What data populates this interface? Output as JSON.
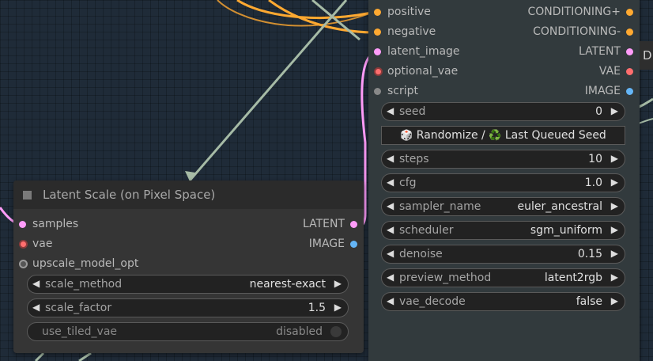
{
  "colors": {
    "canvas_bg": "#1f2b38",
    "node_bg": "#353535",
    "conditioning": "#ffa931",
    "latent": "#ff9cf9",
    "vae": "#ff6e6e",
    "image": "#64b5f6",
    "script": "#888888",
    "wire_image": "#a6bba6"
  },
  "ksampler": {
    "inputs": [
      {
        "label": "positive",
        "color": "#ffa931"
      },
      {
        "label": "negative",
        "color": "#ffa931"
      },
      {
        "label": "latent_image",
        "color": "#ff9cf9"
      },
      {
        "label": "optional_vae",
        "color": "#ff6e6e"
      },
      {
        "label": "script",
        "color": "#888888"
      }
    ],
    "outputs": [
      {
        "label": "CONDITIONING+",
        "color": "#ffa931"
      },
      {
        "label": "CONDITIONING-",
        "color": "#ffa931"
      },
      {
        "label": "LATENT",
        "color": "#ff9cf9"
      },
      {
        "label": "VAE",
        "color": "#ff6e6e"
      },
      {
        "label": "IMAGE",
        "color": "#64b5f6"
      }
    ],
    "widgets": {
      "seed": {
        "name": "seed",
        "value": "0"
      },
      "randomize": {
        "dice_icon": "🎲",
        "left_text": "Randomize /",
        "recycle_icon": "♻️",
        "right_text": "Last Queued Seed"
      },
      "steps": {
        "name": "steps",
        "value": "10"
      },
      "cfg": {
        "name": "cfg",
        "value": "1.0"
      },
      "sampler_name": {
        "name": "sampler_name",
        "value": "euler_ancestral"
      },
      "scheduler": {
        "name": "scheduler",
        "value": "sgm_uniform"
      },
      "denoise": {
        "name": "denoise",
        "value": "0.15"
      },
      "preview_method": {
        "name": "preview_method",
        "value": "latent2rgb"
      },
      "vae_decode": {
        "name": "vae_decode",
        "value": "false"
      }
    }
  },
  "latent_scale": {
    "title": "Latent Scale (on Pixel Space)",
    "inputs": [
      {
        "label": "samples",
        "color": "#ff9cf9"
      },
      {
        "label": "vae",
        "color": "#ff6e6e"
      },
      {
        "label": "upscale_model_opt",
        "color": "#888888"
      }
    ],
    "outputs": [
      {
        "label": "LATENT",
        "color": "#ff9cf9"
      },
      {
        "label": "IMAGE",
        "color": "#64b5f6"
      }
    ],
    "widgets": {
      "scale_method": {
        "name": "scale_method",
        "value": "nearest-exact"
      },
      "scale_factor": {
        "name": "scale_factor",
        "value": "1.5"
      },
      "use_tiled_vae": {
        "name": "use_tiled_vae",
        "value": "disabled"
      }
    }
  },
  "side_tab": {
    "label": "D"
  },
  "icons": {
    "arrow_left": "◀",
    "arrow_right": "▶"
  }
}
